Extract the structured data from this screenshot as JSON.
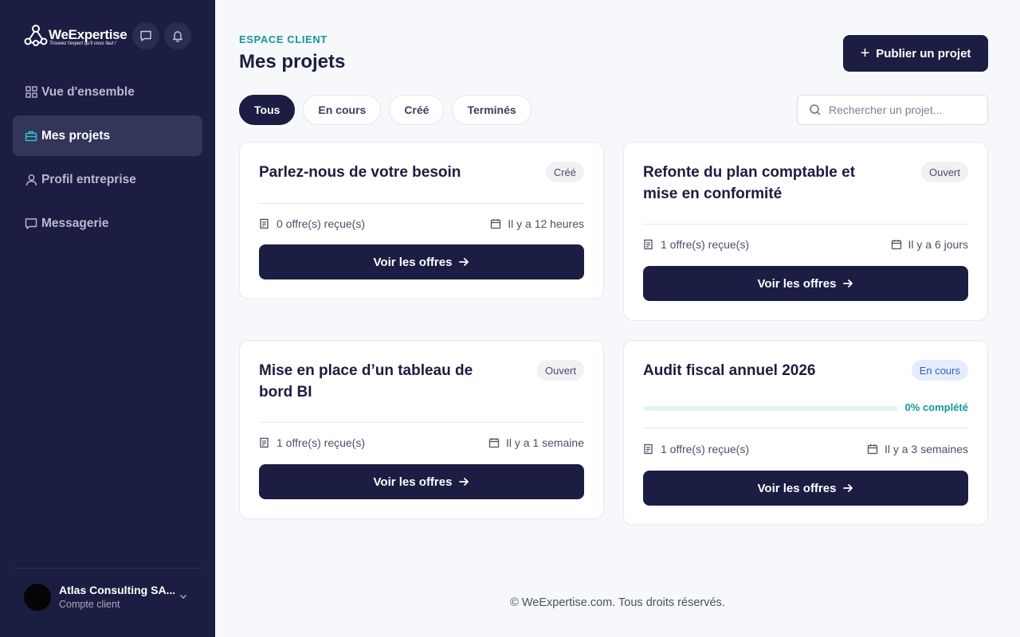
{
  "brand": {
    "name": "WeExpertise",
    "tagline": "Trouvez l'expert qu'il vous faut !"
  },
  "sidebar": {
    "items": [
      {
        "label": "Vue d'ensemble",
        "icon": "grid-icon",
        "active": false
      },
      {
        "label": "Mes projets",
        "icon": "briefcase-icon",
        "active": true
      },
      {
        "label": "Profil entreprise",
        "icon": "user-icon",
        "active": false
      },
      {
        "label": "Messagerie",
        "icon": "chat-icon",
        "active": false
      }
    ],
    "account": {
      "name": "Atlas Consulting SA...",
      "role": "Compte client"
    }
  },
  "header": {
    "kicker": "ESPACE CLIENT",
    "title": "Mes projets",
    "publish_label": "Publier un projet"
  },
  "filters": [
    "Tous",
    "En cours",
    "Créé",
    "Terminés"
  ],
  "active_filter": "Tous",
  "search": {
    "placeholder": "Rechercher un projet...",
    "value": ""
  },
  "projects": [
    {
      "title": "Parlez-nous de votre besoin",
      "status": "Créé",
      "offers": "0 offre(s) reçue(s)",
      "date": "Il y a 12 heures",
      "cta": "Voir les offres"
    },
    {
      "title": "Refonte du plan comptable et mise en conformité",
      "status": "Ouvert",
      "offers": "1 offre(s) reçue(s)",
      "date": "Il y a 6 jours",
      "cta": "Voir les offres"
    },
    {
      "title": "Mise en place d’un tableau de bord BI",
      "status": "Ouvert",
      "offers": "1 offre(s) reçue(s)",
      "date": "Il y a 1 semaine",
      "cta": "Voir les offres"
    },
    {
      "title": "Audit fiscal annuel 2026",
      "status": "En cours",
      "progress": 0,
      "progress_label": "0% complété",
      "offers": "1 offre(s) reçue(s)",
      "date": "Il y a 3 semaines",
      "cta": "Voir les offres"
    }
  ],
  "footer": "© WeExpertise.com. Tous droits réservés.",
  "colors": {
    "sidebar_bg": "#1c1d42",
    "accent_teal": "#15979b",
    "primary_button": "#1c1d42",
    "badge_blue_bg": "#e4edfd",
    "badge_blue_text": "#2f5fc9"
  }
}
